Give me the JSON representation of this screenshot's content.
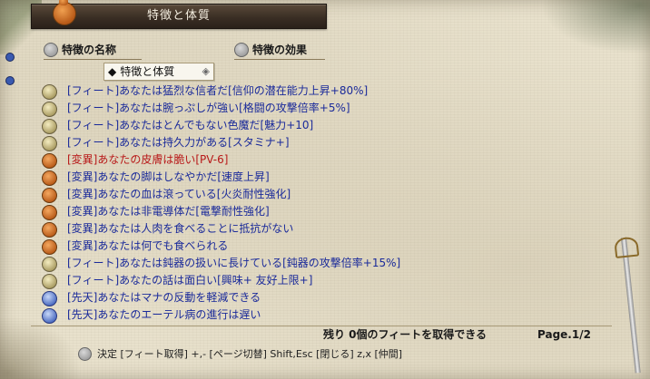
{
  "window": {
    "title": "特徴と体質"
  },
  "columns": {
    "name_label": "特徴の名称",
    "effect_label": "特徴の効果"
  },
  "sort": {
    "label": "特徴と体質",
    "diamond": "◆",
    "gear": "◈"
  },
  "traits": [
    {
      "text": "[フィート]あなたは猛烈な信者だ[信仰の潜在能力上昇+80%]",
      "color": "#1a2a9a",
      "icon": "feat-icon"
    },
    {
      "text": "[フィート]あなたは腕っぷしが強い[格闘の攻撃倍率+5%]",
      "color": "#1a2a9a",
      "icon": "feat-icon"
    },
    {
      "text": "[フィート]あなたはとんでもない色魔だ[魅力+10]",
      "color": "#1a2a9a",
      "icon": "feat-icon"
    },
    {
      "text": "[フィート]あなたは持久力がある[スタミナ+]",
      "color": "#1a2a9a",
      "icon": "feat-icon"
    },
    {
      "text": "[変異]あなたの皮膚は脆い[PV-6]",
      "color": "#b81818",
      "icon": "mutation-icon"
    },
    {
      "text": "[変異]あなたの脚はしなやかだ[速度上昇]",
      "color": "#1a2a9a",
      "icon": "mutation-icon"
    },
    {
      "text": "[変異]あなたの血は滾っている[火炎耐性強化]",
      "color": "#1a2a9a",
      "icon": "mutation-icon"
    },
    {
      "text": "[変異]あなたは非電導体だ[電撃耐性強化]",
      "color": "#1a2a9a",
      "icon": "mutation-icon"
    },
    {
      "text": "[変異]あなたは人肉を食べることに抵抗がない",
      "color": "#1a2a9a",
      "icon": "mutation-icon"
    },
    {
      "text": "[変異]あなたは何でも食べられる",
      "color": "#1a2a9a",
      "icon": "mutation-icon"
    },
    {
      "text": "[フィート]あなたは鈍器の扱いに長けている[鈍器の攻撃倍率+15%]",
      "color": "#1a2a9a",
      "icon": "feat-icon"
    },
    {
      "text": "[フィート]あなたの話は面白い[興味+ 友好上限+]",
      "color": "#1a2a9a",
      "icon": "feat-icon"
    },
    {
      "text": "[先天]あなたはマナの反動を軽減できる",
      "color": "#1a2a9a",
      "icon": "innate-icon"
    },
    {
      "text": "[先天]あなたのエーテル病の進行は遅い",
      "color": "#1a2a9a",
      "icon": "innate-icon"
    }
  ],
  "footer": {
    "remaining": "残り 0個のフィートを取得できる",
    "page": "Page.1/2",
    "hint": "決定 [フィート取得]  +,- [ページ切替]  Shift,Esc [閉じる]  z,x [仲間]"
  }
}
